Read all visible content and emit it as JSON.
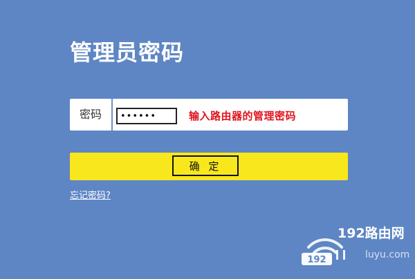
{
  "page": {
    "title": "管理员密码"
  },
  "form": {
    "password_label": "密码",
    "password_value": "••••••",
    "password_hint": "输入路由器的管理密码",
    "confirm_label": "确 定",
    "forgot_link": "忘记密码?"
  },
  "watermark": {
    "brand": "192路由网",
    "badge_text": "192",
    "domain": "luyu.com"
  },
  "colors": {
    "background": "#5e86c4",
    "confirm_bar": "#f8e71c",
    "hint": "#e0141e"
  }
}
